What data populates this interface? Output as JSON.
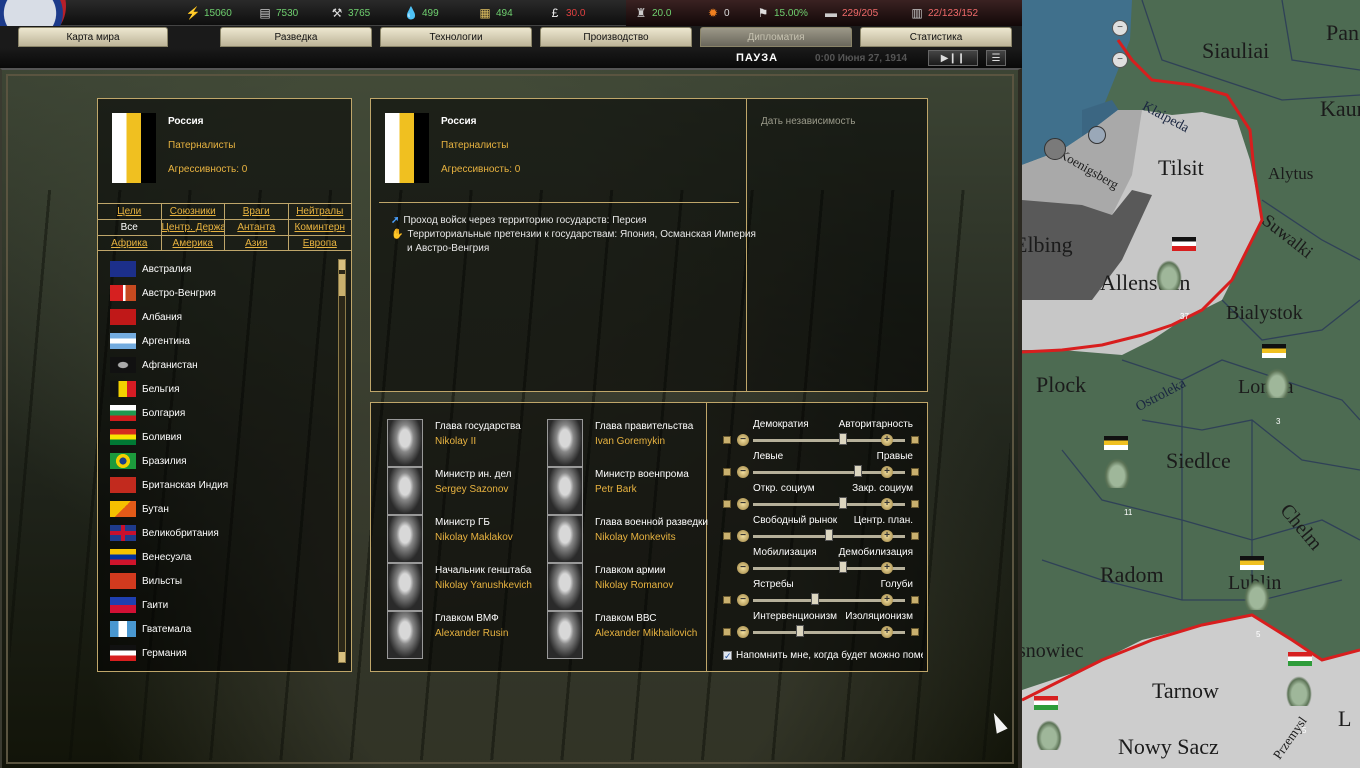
{
  "resources": {
    "energy": "15060",
    "metal": "7530",
    "rare": "3765",
    "oil": "499",
    "supplies": "494",
    "money": "30.0",
    "manpower": "20.0",
    "nukes": "0",
    "dissent": "15.00%",
    "transports": "229/205",
    "convoys": "22/123/152"
  },
  "tabs": [
    {
      "label": "Карта мира"
    },
    {
      "label": "Разведка"
    },
    {
      "label": "Технологии"
    },
    {
      "label": "Производство"
    },
    {
      "label": "Дипломатия"
    },
    {
      "label": "Статистика"
    }
  ],
  "status": {
    "pause": "ПАУЗА",
    "date": "0:00 Июня 27, 1914"
  },
  "left_panel": {
    "country": "Россия",
    "party": "Патерналисты",
    "aggression": "Агрессивность: 0",
    "filters": [
      [
        {
          "label": "Цели"
        },
        {
          "label": "Союзники"
        },
        {
          "label": "Враги"
        },
        {
          "label": "Нейтралы"
        }
      ],
      [
        {
          "label": "Все",
          "selected": true
        },
        {
          "label": "Центр. Держав"
        },
        {
          "label": "Антанта"
        },
        {
          "label": "Коминтерн"
        }
      ],
      [
        {
          "label": "Африка"
        },
        {
          "label": "Америка"
        },
        {
          "label": "Азия"
        },
        {
          "label": "Европа"
        }
      ]
    ],
    "countries": [
      {
        "name": "Австралия",
        "flag": "australia"
      },
      {
        "name": "Австро-Венгрия",
        "flag": "austria-hungary"
      },
      {
        "name": "Албания",
        "flag": "albania"
      },
      {
        "name": "Аргентина",
        "flag": "argentina"
      },
      {
        "name": "Афганистан",
        "flag": "afghanistan"
      },
      {
        "name": "Бельгия",
        "flag": "belgium"
      },
      {
        "name": "Болгария",
        "flag": "bulgaria"
      },
      {
        "name": "Боливия",
        "flag": "bolivia"
      },
      {
        "name": "Бразилия",
        "flag": "brazil"
      },
      {
        "name": "Британская Индия",
        "flag": "british-india"
      },
      {
        "name": "Бутан",
        "flag": "bhutan"
      },
      {
        "name": "Великобритания",
        "flag": "uk"
      },
      {
        "name": "Венесуэла",
        "flag": "venezuela"
      },
      {
        "name": "Вильсты",
        "flag": "vilsty"
      },
      {
        "name": "Гаити",
        "flag": "haiti"
      },
      {
        "name": "Гватемала",
        "flag": "guatemala"
      },
      {
        "name": "Германия",
        "flag": "germany"
      }
    ]
  },
  "detail": {
    "country": "Россия",
    "party": "Патерналисты",
    "aggression": "Агрессивность: 0",
    "relations": [
      {
        "icon": "arrow-icon",
        "text": "Проход войск через территорию государств: Персия"
      },
      {
        "icon": "hand-icon",
        "text": "Территориальные претензии к государствам: Япония, Османская Империя",
        "text2": "и Австро-Венгрия"
      }
    ],
    "action": "Дать независимость"
  },
  "ministers": [
    {
      "role": "Глава государства",
      "name": "Nikolay II"
    },
    {
      "role": "Глава правительства",
      "name": "Ivan Goremykin"
    },
    {
      "role": "Министр ин. дел",
      "name": "Sergey Sazonov"
    },
    {
      "role": "Министр военпрома",
      "name": "Petr Bark"
    },
    {
      "role": "Министр ГБ",
      "name": "Nikolay Maklakov"
    },
    {
      "role": "Глава военной разведки",
      "name": "Nikolay Monkevits"
    },
    {
      "role": "Начальник генштаба",
      "name": "Nikolay Yanushkevich"
    },
    {
      "role": "Главком армии",
      "name": "Nikolay Romanov"
    },
    {
      "role": "Главком ВМФ",
      "name": "Alexander Rusin"
    },
    {
      "role": "Главком ВВС",
      "name": "Alexander Mikhailovich"
    }
  ],
  "policies": [
    {
      "left": "Демократия",
      "right": "Авторитарность",
      "value": 0.6
    },
    {
      "left": "Левые",
      "right": "Правые",
      "value": 0.7
    },
    {
      "left": "Откр. социум",
      "right": "Закр. социум",
      "value": 0.6
    },
    {
      "left": "Свободный рынок",
      "right": "Центр. план.",
      "value": 0.5
    },
    {
      "left": "Мобилизация",
      "right": "Демобилизация",
      "value": 0.6
    },
    {
      "left": "Ястребы",
      "right": "Голуби",
      "value": 0.4
    },
    {
      "left": "Интервенционизм",
      "right": "Изоляционизм",
      "value": 0.3
    }
  ],
  "remind": "Напомнить мне, когда будет можно поменять настройки внутренней политики",
  "map": {
    "labels": [
      {
        "text": "Siauliai"
      },
      {
        "text": "Pan"
      },
      {
        "text": "Kaun"
      },
      {
        "text": "Klaipeda"
      },
      {
        "text": "Tilsit"
      },
      {
        "text": "Koenigsberg"
      },
      {
        "text": "Alytus"
      },
      {
        "text": "Elbing"
      },
      {
        "text": "Suwalki"
      },
      {
        "text": "Allenstein"
      },
      {
        "text": "Bialystok"
      },
      {
        "text": "Plock"
      },
      {
        "text": "Lomza"
      },
      {
        "text": "Ostroleka"
      },
      {
        "text": "Siedlce"
      },
      {
        "text": "Radom"
      },
      {
        "text": "Chelm"
      },
      {
        "text": "Lublin"
      },
      {
        "text": "Tarnow"
      },
      {
        "text": "Nowy Sacz"
      },
      {
        "text": "snowiec"
      },
      {
        "text": "Przemysl"
      },
      {
        "text": "L"
      }
    ],
    "unit_counts": [
      "37",
      "3",
      "11",
      "5",
      "5"
    ]
  },
  "colors": {
    "accent": "#e8b340",
    "border": "#bfa66a",
    "map_land": "#4d6b52",
    "map_enemy": "#c8c8c8",
    "frontline": "#d81e1e"
  }
}
